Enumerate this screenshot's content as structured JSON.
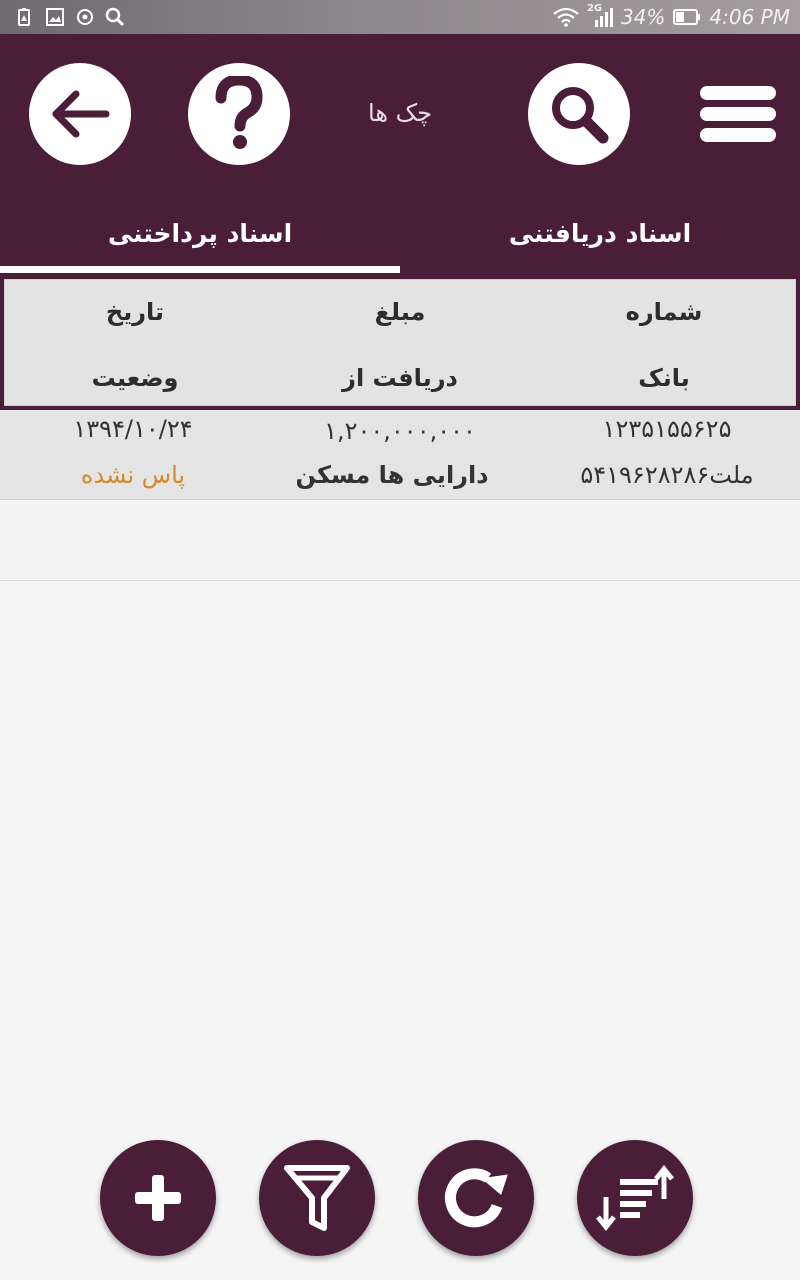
{
  "status_bar": {
    "battery": "34%",
    "time": "4:06 PM",
    "network": "2G",
    "left_icons": [
      "battery-saver-icon",
      "image-icon",
      "sync-icon",
      "search-icon"
    ]
  },
  "header": {
    "title": "چک ها",
    "buttons": [
      "menu-icon",
      "search-icon",
      "help-icon",
      "back-arrow-icon"
    ]
  },
  "tabs": [
    {
      "label": "اسناد دریافتنی",
      "active": false
    },
    {
      "label": "اسناد پرداختنی",
      "active": true
    }
  ],
  "columns": {
    "row1": [
      "شماره",
      "مبلغ",
      "تاریخ"
    ],
    "row2": [
      "بانک",
      "دریافت از",
      "وضعیت"
    ]
  },
  "rows": [
    {
      "number": "۱۲۳۵۱۵۵۶۲۵",
      "amount": "۱,۲۰۰,۰۰۰,۰۰۰",
      "date": "۱۳۹۴/۱۰/۲۴",
      "bank": "ملت۵۴۱۹۶۲۸۲۸۶",
      "received_from": "دارایی ها  مسکن",
      "status": "پاس نشده"
    }
  ],
  "colors": {
    "primary": "#4a1d38",
    "status_pending": "#d4892e"
  },
  "fabs": [
    "sort-icon",
    "refresh-icon",
    "filter-icon",
    "add-icon"
  ]
}
